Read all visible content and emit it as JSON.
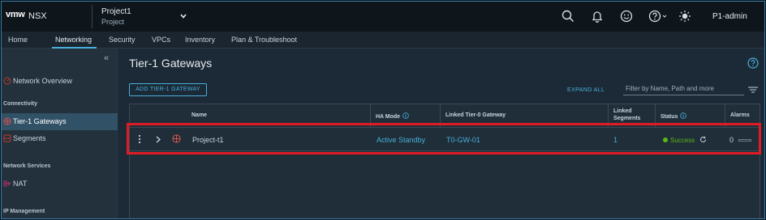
{
  "header": {
    "logo": "vmw",
    "product": "NSX",
    "project_name": "Project1",
    "project_sub": "Project",
    "user": "P1-admin"
  },
  "tabs": [
    "Home",
    "Networking",
    "Security",
    "VPCs",
    "Inventory",
    "Plan & Troubleshoot"
  ],
  "active_tab": "Networking",
  "sidebar": {
    "collapse_glyph": "«",
    "overview": "Network Overview",
    "section_connectivity": "Connectivity",
    "tier1": "Tier-1 Gateways",
    "segments": "Segments",
    "section_network_services": "Network Services",
    "nat": "NAT",
    "section_ip_management": "IP Management"
  },
  "main": {
    "title": "Tier-1 Gateways",
    "add_button": "ADD TIER-1 GATEWAY",
    "expand_all": "EXPAND ALL",
    "filter_placeholder": "Filter by Name, Path and more"
  },
  "grid": {
    "headers": {
      "name": "Name",
      "ha_mode": "HA Mode",
      "linked_tier0": "Linked Tier-0 Gateway",
      "linked_segments_1": "Linked",
      "linked_segments_2": "Segments",
      "status": "Status",
      "alarms": "Alarms"
    },
    "row": {
      "name": "Project-t1",
      "ha_mode": "Active Standby",
      "linked_tier0": "T0-GW-01",
      "linked_segments": "1",
      "status": "Success",
      "alarms": "0"
    }
  },
  "colors": {
    "accent": "#49afd9",
    "success": "#60b515",
    "highlight": "#e01b24",
    "active_nav": "#315166"
  },
  "icons": [
    "search-icon",
    "bell-icon",
    "smiley-icon",
    "help-icon",
    "theme-sun-icon",
    "info-icon",
    "refresh-icon",
    "filter-lines-icon"
  ]
}
